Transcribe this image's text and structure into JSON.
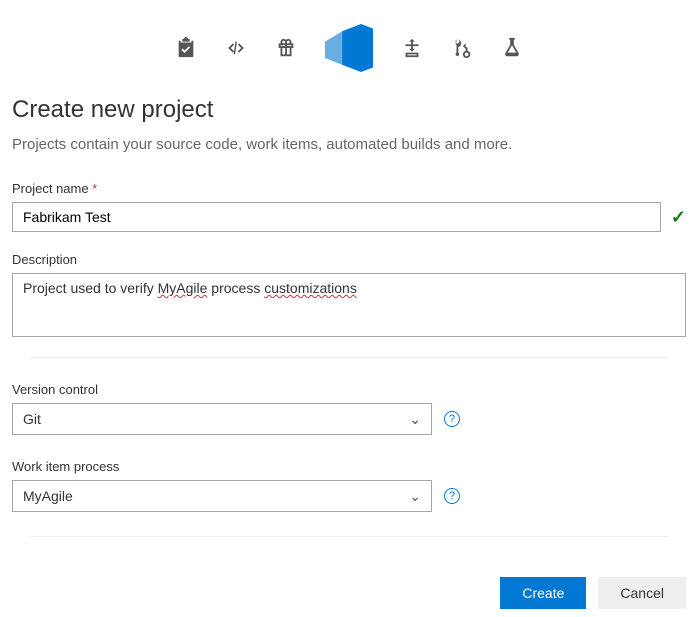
{
  "toolbar": {
    "icons": [
      "clipboard-check-icon",
      "code-brackets-icon",
      "gift-icon",
      "azure-devops-icon",
      "pipeline-icon",
      "pull-request-icon",
      "flask-icon"
    ]
  },
  "header": {
    "title": "Create new project",
    "subtitle": "Projects contain your source code, work items, automated builds and more."
  },
  "form": {
    "project_name": {
      "label": "Project name",
      "value": "Fabrikam Test"
    },
    "description": {
      "label": "Description",
      "value_pre": "Project used to verify ",
      "value_mid": "MyAgile",
      "value_mid2": " process ",
      "value_end": "customizations"
    },
    "version_control": {
      "label": "Version control",
      "selected": "Git"
    },
    "work_item_process": {
      "label": "Work item process",
      "selected": "MyAgile"
    }
  },
  "footer": {
    "create": "Create",
    "cancel": "Cancel"
  }
}
